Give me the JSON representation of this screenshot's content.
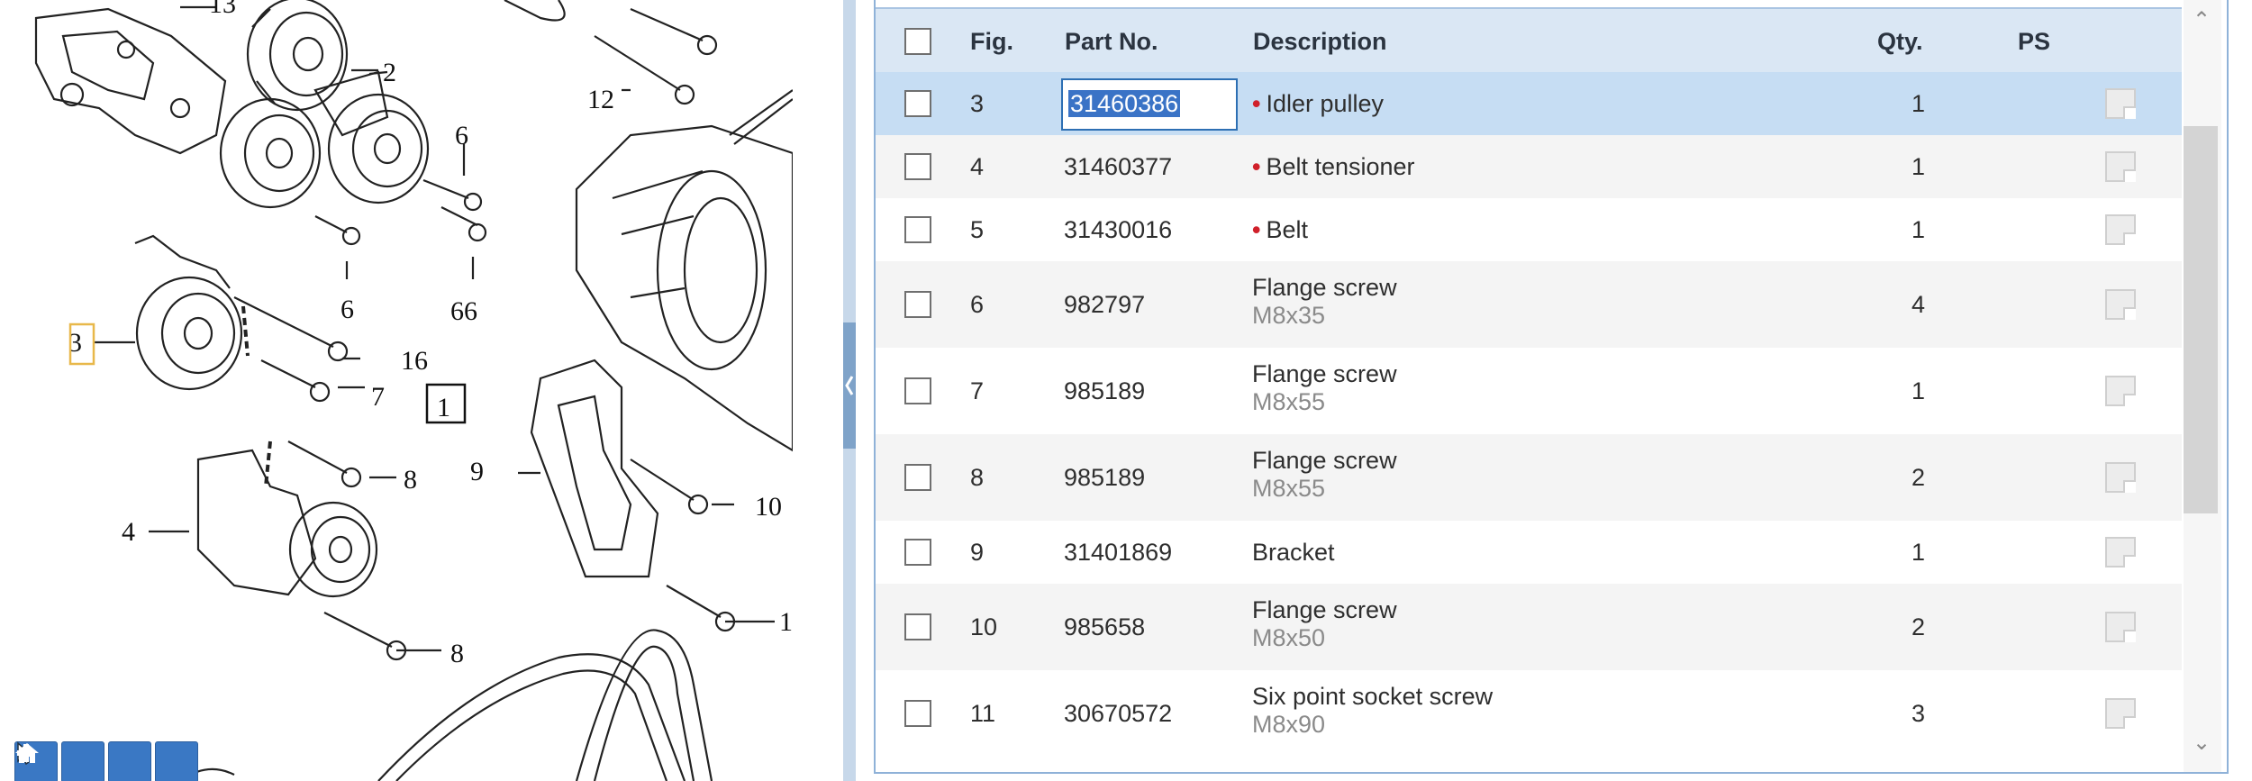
{
  "diagram": {
    "labels": [
      "13",
      "2",
      "12",
      "6",
      "6",
      "6",
      "6",
      "3",
      "16",
      "7",
      "1",
      "9",
      "10",
      "1",
      "4",
      "8",
      "8"
    ],
    "toolbar": [
      "pointer-icon",
      "zoom-in-icon",
      "zoom-out-icon",
      "home-icon"
    ]
  },
  "table": {
    "headers": {
      "fig": "Fig.",
      "part_no": "Part No.",
      "description": "Description",
      "qty": "Qty.",
      "ps": "PS"
    },
    "rows": [
      {
        "fig": "3",
        "part_no": "31460386",
        "desc": "Idler pulley",
        "sub": "",
        "qty": "1",
        "dot": true,
        "selected": true
      },
      {
        "fig": "4",
        "part_no": "31460377",
        "desc": "Belt tensioner",
        "sub": "",
        "qty": "1",
        "dot": true,
        "selected": false
      },
      {
        "fig": "5",
        "part_no": "31430016",
        "desc": "Belt",
        "sub": "",
        "qty": "1",
        "dot": true,
        "selected": false
      },
      {
        "fig": "6",
        "part_no": "982797",
        "desc": "Flange screw",
        "sub": "M8x35",
        "qty": "4",
        "dot": false,
        "selected": false
      },
      {
        "fig": "7",
        "part_no": "985189",
        "desc": "Flange screw",
        "sub": "M8x55",
        "qty": "1",
        "dot": false,
        "selected": false
      },
      {
        "fig": "8",
        "part_no": "985189",
        "desc": "Flange screw",
        "sub": "M8x55",
        "qty": "2",
        "dot": false,
        "selected": false
      },
      {
        "fig": "9",
        "part_no": "31401869",
        "desc": "Bracket",
        "sub": "",
        "qty": "1",
        "dot": false,
        "selected": false
      },
      {
        "fig": "10",
        "part_no": "985658",
        "desc": "Flange screw",
        "sub": "M8x50",
        "qty": "2",
        "dot": false,
        "selected": false
      },
      {
        "fig": "11",
        "part_no": "30670572",
        "desc": "Six point socket screw",
        "sub": "M8x90",
        "qty": "3",
        "dot": false,
        "selected": false
      }
    ]
  },
  "colors": {
    "accent": "#3a78c4",
    "header_bg": "#dae7f4",
    "selected_row": "#c6ddf3",
    "bullet": "#d0202a"
  }
}
